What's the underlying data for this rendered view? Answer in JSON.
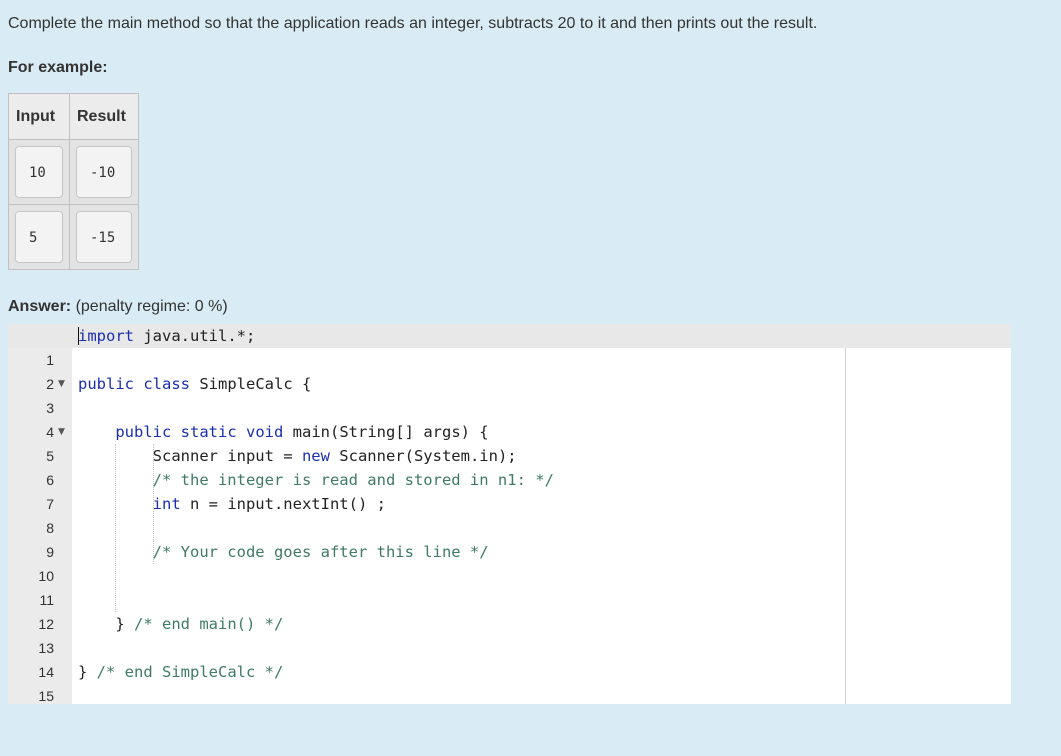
{
  "question": {
    "text": "Complete the main method so that the application reads an integer, subtracts 20 to it and then prints out the result.",
    "for_example": "For example:"
  },
  "examples": {
    "headers": [
      "Input",
      "Result"
    ],
    "rows": [
      {
        "input": "10",
        "result": "-10"
      },
      {
        "input": "5",
        "result": "-15"
      }
    ]
  },
  "answer": {
    "label": "Answer:",
    "penalty": "(penalty regime: 0 %)"
  },
  "editor": {
    "line_numbers": [
      "1",
      "2",
      "3",
      "4",
      "5",
      "6",
      "7",
      "8",
      "9",
      "10",
      "11",
      "12",
      "13",
      "14",
      "15"
    ],
    "lines": [
      "import java.util.*;",
      "",
      "public class SimpleCalc {",
      "",
      "    public static void main(String[] args) {",
      "        Scanner input = new Scanner(System.in);",
      "        /* the integer is read and stored in n1: */",
      "        int n = input.nextInt() ;",
      "",
      "        /* Your code goes after this line */",
      "",
      "",
      "    } /* end main() */",
      "",
      "} /* end SimpleCalc */"
    ]
  }
}
